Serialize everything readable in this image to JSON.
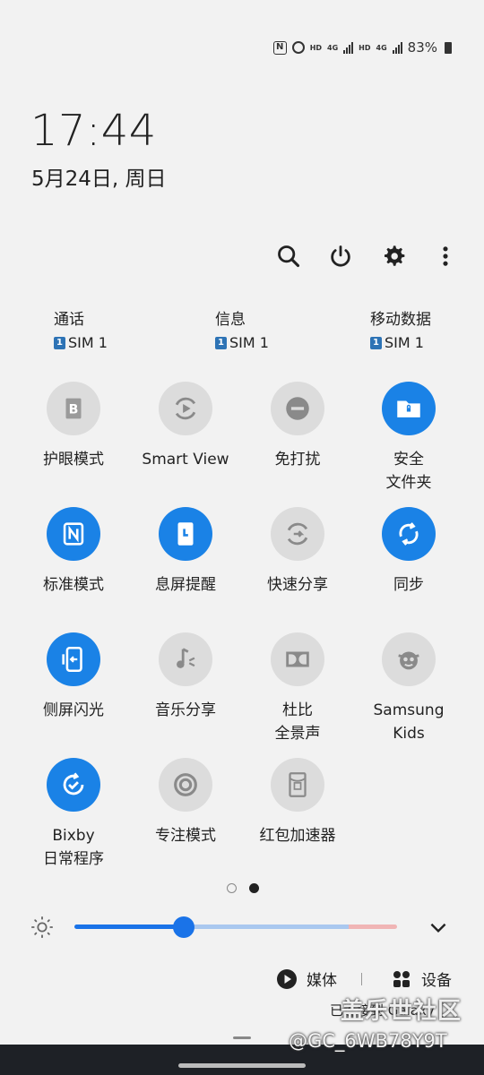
{
  "status_bar": {
    "nfc_icon": "N",
    "hd1": "HD",
    "net1": "4G",
    "hd2": "HD",
    "net2": "4G",
    "battery": "83%"
  },
  "clock": {
    "time": "17:44",
    "date": "5月24日, 周日"
  },
  "toolbar": {
    "icons": [
      "search-icon",
      "power-icon",
      "gear-icon",
      "more-vert-icon"
    ]
  },
  "sim_settings": [
    {
      "name": "通话",
      "badge": "1",
      "sim": "SIM 1"
    },
    {
      "name": "信息",
      "badge": "1",
      "sim": "SIM 1"
    },
    {
      "name": "移动数据",
      "badge": "1",
      "sim": "SIM 1"
    }
  ],
  "tiles": [
    {
      "label": "护眼模式",
      "state": "off",
      "icon": "eye-comfort-icon"
    },
    {
      "label": "Smart View",
      "state": "off",
      "icon": "smart-view-icon"
    },
    {
      "label": "免打扰",
      "state": "off",
      "icon": "do-not-disturb-icon"
    },
    {
      "label": "安全\n文件夹",
      "state": "on",
      "icon": "secure-folder-icon"
    },
    {
      "label": "标准模式",
      "state": "on",
      "icon": "nfc-icon"
    },
    {
      "label": "息屏提醒",
      "state": "on",
      "icon": "always-on-display-icon"
    },
    {
      "label": "快速分享",
      "state": "off",
      "icon": "quick-share-icon"
    },
    {
      "label": "同步",
      "state": "on",
      "icon": "sync-icon"
    },
    {
      "label": "侧屏闪光",
      "state": "on",
      "icon": "edge-lighting-icon"
    },
    {
      "label": "音乐分享",
      "state": "off",
      "icon": "music-share-icon"
    },
    {
      "label": "杜比\n全景声",
      "state": "off",
      "icon": "dolby-atmos-icon"
    },
    {
      "label": "Samsung\nKids",
      "state": "off",
      "icon": "samsung-kids-icon"
    },
    {
      "label": "Bixby\n日常程序",
      "state": "on",
      "icon": "bixby-routines-icon"
    },
    {
      "label": "专注模式",
      "state": "off",
      "icon": "focus-mode-icon"
    },
    {
      "label": "红包加速器",
      "state": "off",
      "icon": "red-envelope-icon"
    }
  ],
  "page_indicator": {
    "current": 2,
    "total": 2
  },
  "brightness": {
    "level": 0.34
  },
  "media": {
    "media_label": "媒体",
    "devices_label": "设备",
    "connected_text": "已连接到 Galaxy"
  },
  "watermarks": {
    "site": "盖乐世社区",
    "user": "@GC_6WB78Y9T"
  },
  "colors": {
    "accent": "#1a82e6",
    "tile_off": "#dcdcdc",
    "background": "#f2f2f2"
  }
}
